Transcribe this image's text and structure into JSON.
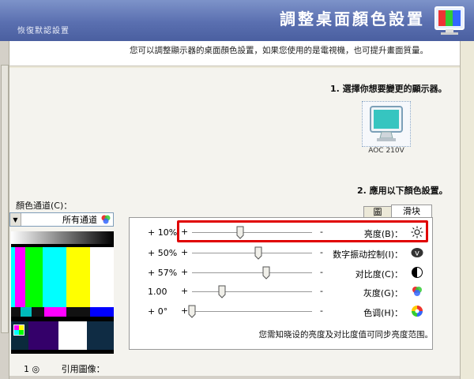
{
  "header": {
    "title": "調整桌面顏色設置",
    "subtitle": "恢復默認設置",
    "icon": "display-color-icon"
  },
  "description": "您可以調整顯示器的桌面顏色設置，如果您使用的是電視機，也可提升畫面質量。",
  "step1": {
    "label": "1. 選擇你想要變更的顯示器。",
    "monitor_name": "AOC 210V"
  },
  "step2": {
    "label": "2. 應用以下顏色設置。"
  },
  "channel": {
    "label": "顏色通道(C)：",
    "selected": "所有通道"
  },
  "reference": {
    "label": "引用圖像：",
    "option": "1 ◎"
  },
  "tabs": [
    "滑块",
    "圖"
  ],
  "sliders": [
    {
      "label": "亮度(B)：",
      "value": "+ 10%",
      "position": 0.4,
      "icon": "brightness-sun-icon"
    },
    {
      "label": "数字振动控制(I)：",
      "value": "+ 50%",
      "position": 0.55,
      "icon": "vibrance-v-icon"
    },
    {
      "label": "对比度(C)：",
      "value": "+ 57%",
      "position": 0.62,
      "icon": "contrast-half-circle-icon"
    },
    {
      "label": "灰度(G)：",
      "value": "1.00",
      "position": 0.25,
      "icon": "gamma-color-icon"
    },
    {
      "label": "色调(H)：",
      "value": "+ 0°",
      "position": 0.0,
      "icon": "hue-color-wheel-icon"
    }
  ],
  "note": "您需知晓设的亮度及对比度值可同步亮度范围。",
  "colors": {
    "header_top": "#7d93c9",
    "header_bottom": "#4a5fa0",
    "highlight": "#e00000"
  }
}
